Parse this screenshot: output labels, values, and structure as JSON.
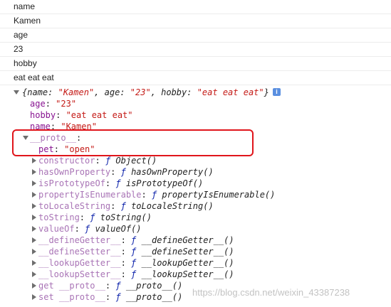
{
  "log_lines": [
    {
      "text": "name"
    },
    {
      "text": "Kamen"
    },
    {
      "text": "age"
    },
    {
      "text": "23"
    },
    {
      "text": "hobby"
    },
    {
      "text": "eat eat eat"
    }
  ],
  "object": {
    "preview": {
      "open_brace": "{",
      "name_key": "name",
      "name_val": "\"Kamen\"",
      "age_key": "age",
      "age_val": "\"23\"",
      "hobby_key": "hobby",
      "hobby_val": "\"eat eat eat\"",
      "close_brace": "}",
      "sep": ": ",
      "comma": ", "
    },
    "props": [
      {
        "key": "age",
        "value": "\"23\""
      },
      {
        "key": "hobby",
        "value": "\"eat eat eat\""
      },
      {
        "key": "name",
        "value": "\"Kamen\""
      }
    ],
    "proto": {
      "label": "__proto__",
      "suffix": ":",
      "child": {
        "key": "pet",
        "value": "\"open\""
      }
    },
    "inner_proto_items": [
      {
        "key": "constructor",
        "f": "ƒ",
        "name": "Object()"
      },
      {
        "key": "hasOwnProperty",
        "f": "ƒ",
        "name": "hasOwnProperty()"
      },
      {
        "key": "isPrototypeOf",
        "f": "ƒ",
        "name": "isPrototypeOf()"
      },
      {
        "key": "propertyIsEnumerable",
        "f": "ƒ",
        "name": "propertyIsEnumerable()"
      },
      {
        "key": "toLocaleString",
        "f": "ƒ",
        "name": "toLocaleString()"
      },
      {
        "key": "toString",
        "f": "ƒ",
        "name": "toString()"
      },
      {
        "key": "valueOf",
        "f": "ƒ",
        "name": "valueOf()"
      },
      {
        "key": "__defineGetter__",
        "f": "ƒ",
        "name": "__defineGetter__()"
      },
      {
        "key": "__defineSetter__",
        "f": "ƒ",
        "name": "__defineSetter__()"
      },
      {
        "key": "__lookupGetter__",
        "f": "ƒ",
        "name": "__lookupGetter__()"
      },
      {
        "key": "__lookupSetter__",
        "f": "ƒ",
        "name": "__lookupSetter__()"
      },
      {
        "key": "get __proto__",
        "f": "ƒ",
        "name": "__proto__()"
      },
      {
        "key": "set __proto__",
        "f": "ƒ",
        "name": "__proto__()"
      }
    ]
  },
  "info_icon": {
    "glyph": "i",
    "semantic": "info-icon"
  },
  "watermark": "https://blog.csdn.net/weixin_43387238"
}
